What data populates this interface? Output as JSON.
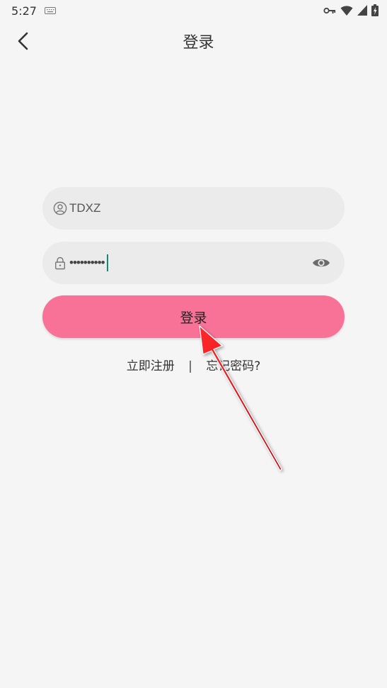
{
  "status_bar": {
    "time": "5:27"
  },
  "header": {
    "title": "登录"
  },
  "form": {
    "username_value": "TDXZ",
    "password_mask": "••••••••••",
    "login_label": "登录"
  },
  "links": {
    "register": "立即注册",
    "separator": "|",
    "forgot": "忘记密码?"
  },
  "colors": {
    "accent": "#f87298",
    "background": "#f5f5f5",
    "field_bg": "#ebebeb",
    "caret": "#148a7a",
    "annotation_arrow": "#e8000b"
  },
  "icons": {
    "back": "back-arrow-icon",
    "user": "user-icon",
    "lock": "lock-icon",
    "eye": "eye-icon"
  }
}
